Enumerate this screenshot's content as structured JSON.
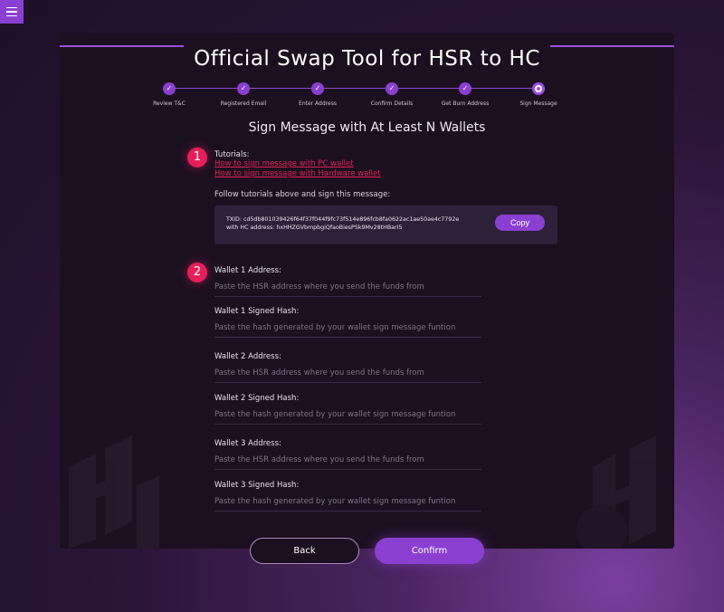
{
  "app": {
    "title": "Official Swap Tool for HSR to HC",
    "menu_icon": "hamburger-menu-icon"
  },
  "steps": [
    {
      "label": "Review T&C",
      "state": "done"
    },
    {
      "label": "Registered Email",
      "state": "done"
    },
    {
      "label": "Enter Address",
      "state": "done"
    },
    {
      "label": "Confirm Details",
      "state": "done"
    },
    {
      "label": "Get Burn Address",
      "state": "done"
    },
    {
      "label": "Sign Message",
      "state": "current"
    }
  ],
  "subtitle": "Sign Message with At Least N Wallets",
  "section1": {
    "number": "1",
    "tutorials_label": "Tutorials:",
    "link_pc": "How to sign message with PC wallet",
    "link_hw": "How to sign message with Hardware wallet",
    "follow_text": "Follow tutorials above and sign this message:",
    "message_line1": "TXID: cd5db801039426f64f37f044f9fc73f514e896fcb8fa0622ac1ae50ae4c7792e",
    "message_line2": "with HC address: hxHHZGVbmpbgiQfaoBiesPSk9Mv28tHBarI5",
    "copy_label": "Copy"
  },
  "section2": {
    "number": "2",
    "fields": [
      {
        "label": "Wallet 1 Address:",
        "placeholder": "Paste the HSR address where you send the funds from"
      },
      {
        "label": "Wallet 1 Signed Hash:",
        "placeholder": "Paste the hash generated by your wallet sign message funtion"
      },
      {
        "label": "Wallet 2 Address:",
        "placeholder": "Paste the HSR address where you send the funds from"
      },
      {
        "label": "Wallet 2 Signed Hash:",
        "placeholder": "Paste the hash generated by your wallet sign message funtion"
      },
      {
        "label": "Wallet 3 Address:",
        "placeholder": "Paste the HSR address where you send the funds from"
      },
      {
        "label": "Wallet 3 Signed Hash:",
        "placeholder": "Paste the hash generated by your wallet sign message funtion"
      }
    ]
  },
  "buttons": {
    "back": "Back",
    "confirm": "Confirm"
  },
  "colors": {
    "accent": "#8b3fd1",
    "badge": "#e51f5a",
    "card_bg": "#1b1020"
  }
}
